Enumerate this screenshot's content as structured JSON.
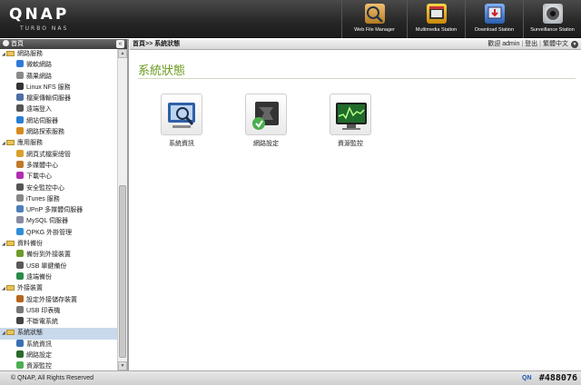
{
  "header": {
    "logo": "QNAP",
    "logo_sub": "TURBO NAS",
    "apps": [
      {
        "label": "Web File Manager",
        "icon": "web-file-manager-icon",
        "color": "#c78b2d"
      },
      {
        "label": "Multimedia Station",
        "icon": "multimedia-station-icon",
        "color": "#d9a316"
      },
      {
        "label": "Download Station",
        "icon": "download-station-icon",
        "color": "#3a78c9"
      },
      {
        "label": "Surveillance Station",
        "icon": "surveillance-station-icon",
        "color": "#9aa0a6"
      }
    ]
  },
  "sidebar": {
    "title": "首頁",
    "collapse": "«",
    "nodes": [
      {
        "type": "cat",
        "label": "網路服務",
        "icon": "folder-icon"
      },
      {
        "type": "item",
        "label": "微軟網路",
        "icon": "windows-icon",
        "color": "#2f7ad8"
      },
      {
        "type": "item",
        "label": "蘋果網路",
        "icon": "apple-icon",
        "color": "#8a8a8a"
      },
      {
        "type": "item",
        "label": "Linux NFS 服務",
        "icon": "linux-icon",
        "color": "#333333"
      },
      {
        "type": "item",
        "label": "檔案傳輸伺服器",
        "icon": "ftp-icon",
        "color": "#4d6fa3"
      },
      {
        "type": "item",
        "label": "遠端登入",
        "icon": "telnet-icon",
        "color": "#555555"
      },
      {
        "type": "item",
        "label": "網站伺服器",
        "icon": "web-server-icon",
        "color": "#2a7fd4"
      },
      {
        "type": "item",
        "label": "網路探索服務",
        "icon": "discovery-icon",
        "color": "#d88a1e"
      },
      {
        "type": "cat",
        "label": "應用服務",
        "icon": "folder-icon"
      },
      {
        "type": "item",
        "label": "網頁式檔案總管",
        "icon": "file-manager-icon",
        "color": "#d9a02a"
      },
      {
        "type": "item",
        "label": "多媒體中心",
        "icon": "multimedia-icon",
        "color": "#c07a2a"
      },
      {
        "type": "item",
        "label": "下載中心",
        "icon": "download-icon",
        "color": "#b02fb0"
      },
      {
        "type": "item",
        "label": "安全監控中心",
        "icon": "surveillance-icon",
        "color": "#555555"
      },
      {
        "type": "item",
        "label": "iTunes 服務",
        "icon": "itunes-icon",
        "color": "#888888"
      },
      {
        "type": "item",
        "label": "UPnP 多媒體伺服器",
        "icon": "upnp-icon",
        "color": "#4f7fb8"
      },
      {
        "type": "item",
        "label": "MySQL 伺服器",
        "icon": "mysql-icon",
        "color": "#8a8aa0"
      },
      {
        "type": "item",
        "label": "QPKG 外掛管理",
        "icon": "qpkg-icon",
        "color": "#2f8fd8"
      },
      {
        "type": "cat",
        "label": "資料備份",
        "icon": "folder-icon"
      },
      {
        "type": "item",
        "label": "備份到外接裝置",
        "icon": "backup-external-icon",
        "color": "#6f9a2a"
      },
      {
        "type": "item",
        "label": "USB 單鍵備份",
        "icon": "usb-backup-icon",
        "color": "#5a5a5a"
      },
      {
        "type": "item",
        "label": "遠端備份",
        "icon": "remote-backup-icon",
        "color": "#2a8a4a"
      },
      {
        "type": "cat",
        "label": "外接裝置",
        "icon": "folder-icon"
      },
      {
        "type": "item",
        "label": "設定外接儲存裝置",
        "icon": "external-storage-icon",
        "color": "#b5651d"
      },
      {
        "type": "item",
        "label": "USB 印表機",
        "icon": "printer-icon",
        "color": "#777777"
      },
      {
        "type": "item",
        "label": "不斷電系統",
        "icon": "ups-icon",
        "color": "#444444"
      },
      {
        "type": "cat",
        "label": "系統狀態",
        "icon": "folder-icon",
        "selected": true
      },
      {
        "type": "item",
        "label": "系統資訊",
        "icon": "system-info-icon",
        "color": "#3a6fb5"
      },
      {
        "type": "item",
        "label": "網路設定",
        "icon": "network-settings-icon",
        "color": "#2a6a2a"
      },
      {
        "type": "item",
        "label": "資源監控",
        "icon": "resource-monitor-icon",
        "color": "#4caf50"
      }
    ]
  },
  "main": {
    "breadcrumb": "首頁>> 系統狀態",
    "user_text": "歡迎 admin",
    "logout": "登出",
    "language": "繁體中文",
    "title": "系統狀態",
    "tiles": [
      {
        "label": "系統資訊",
        "icon": "system-info-tile-icon"
      },
      {
        "label": "網路設定",
        "icon": "network-settings-tile-icon"
      },
      {
        "label": "資源監控",
        "icon": "resource-monitor-tile-icon"
      }
    ]
  },
  "footer": {
    "copyright": "© QNAP, All Rights Reserved",
    "brand": "QN",
    "watermark": "#488076"
  },
  "colors": {
    "header_bg": "#262626",
    "title_green": "#6a9a1e",
    "selection": "#c9d9ec"
  }
}
